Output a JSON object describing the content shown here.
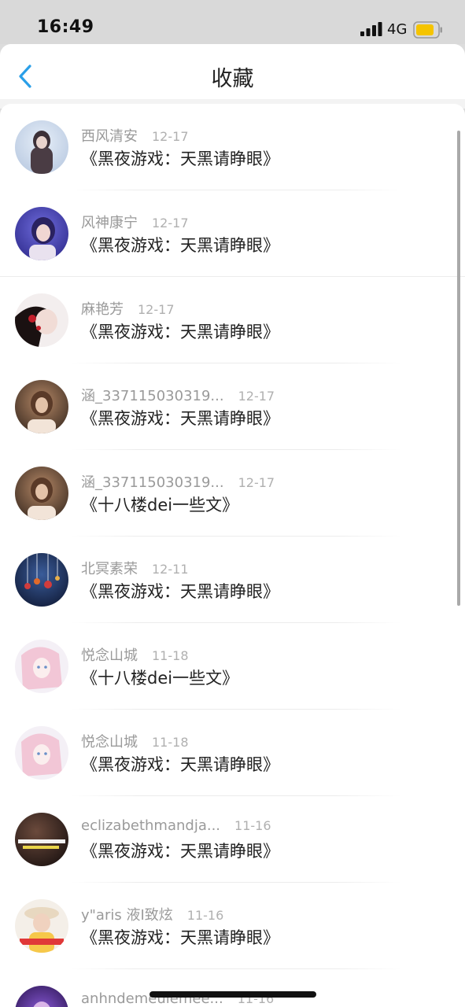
{
  "status_bar": {
    "time": "16:49",
    "network": "4G",
    "signal_icon": "cellular-signal-icon",
    "battery_icon": "battery-icon",
    "battery_color": "#f5c400"
  },
  "header": {
    "title": "收藏",
    "back_icon": "chevron-left-icon",
    "accent_color": "#2a9fe8"
  },
  "list": {
    "items": [
      {
        "user": "西风清安",
        "date": "12-17",
        "title": "《黑夜游戏：天黑请睁眼》"
      },
      {
        "user": "风神康宁",
        "date": "12-17",
        "title": "《黑夜游戏：天黑请睁眼》"
      },
      {
        "user": "麻艳芳",
        "date": "12-17",
        "title": "《黑夜游戏：天黑请睁眼》"
      },
      {
        "user": "涵_337115030319...",
        "date": "12-17",
        "title": "《黑夜游戏：天黑请睁眼》"
      },
      {
        "user": "涵_337115030319...",
        "date": "12-17",
        "title": "《十八楼dei一些文》"
      },
      {
        "user": "北冥素荣",
        "date": "12-11",
        "title": "《黑夜游戏：天黑请睁眼》"
      },
      {
        "user": "悦念山城",
        "date": "11-18",
        "title": "《十八楼dei一些文》"
      },
      {
        "user": "悦念山城",
        "date": "11-18",
        "title": "《黑夜游戏：天黑请睁眼》"
      },
      {
        "user": "eclizabethmandja...",
        "date": "11-16",
        "title": "《黑夜游戏：天黑请睁眼》"
      },
      {
        "user": "y\"aris 液I致炫",
        "date": "11-16",
        "title": "《黑夜游戏：天黑请睁眼》"
      },
      {
        "user": "anhndemeulemee...",
        "date": "11-16",
        "title": ""
      }
    ]
  }
}
